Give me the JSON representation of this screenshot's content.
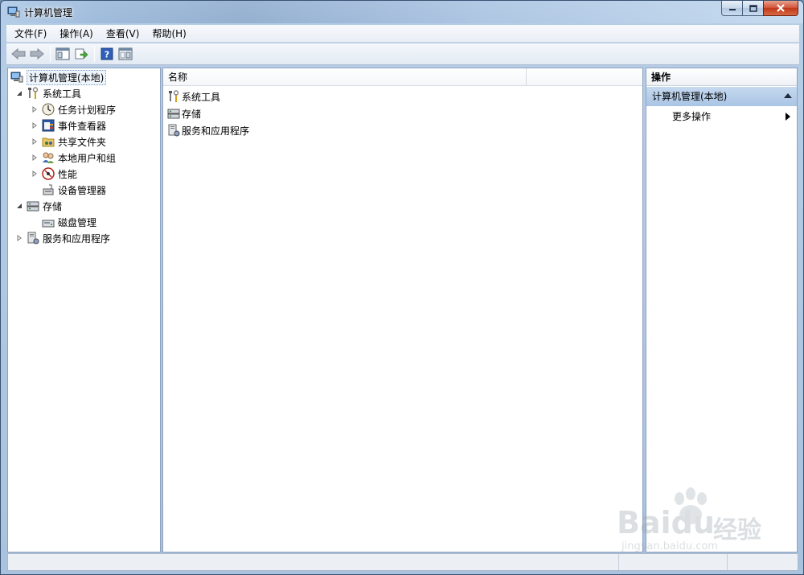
{
  "window": {
    "title": "计算机管理"
  },
  "menubar": {
    "items": [
      "文件(F)",
      "操作(A)",
      "查看(V)",
      "帮助(H)"
    ]
  },
  "toolbar": {
    "buttons": [
      "back-icon",
      "forward-icon",
      "show-tree-icon",
      "export-list-icon",
      "help-icon",
      "show-action-pane-icon"
    ]
  },
  "tree": {
    "root": "计算机管理(本地)",
    "items": [
      {
        "label": "系统工具",
        "level": 1,
        "state": "expanded",
        "icon": "tools-icon"
      },
      {
        "label": "任务计划程序",
        "level": 2,
        "state": "collapsed",
        "icon": "clock-icon"
      },
      {
        "label": "事件查看器",
        "level": 2,
        "state": "collapsed",
        "icon": "event-viewer-icon"
      },
      {
        "label": "共享文件夹",
        "level": 2,
        "state": "collapsed",
        "icon": "shared-folder-icon"
      },
      {
        "label": "本地用户和组",
        "level": 2,
        "state": "collapsed",
        "icon": "users-icon"
      },
      {
        "label": "性能",
        "level": 2,
        "state": "collapsed",
        "icon": "performance-icon"
      },
      {
        "label": "设备管理器",
        "level": 2,
        "state": "leaf",
        "icon": "device-manager-icon"
      },
      {
        "label": "存储",
        "level": 1,
        "state": "expanded",
        "icon": "storage-icon"
      },
      {
        "label": "磁盘管理",
        "level": 2,
        "state": "leaf",
        "icon": "disk-icon"
      },
      {
        "label": "服务和应用程序",
        "level": 1,
        "state": "collapsed",
        "icon": "services-icon"
      }
    ]
  },
  "main": {
    "column_header": "名称",
    "rows": [
      "系统工具",
      "存储",
      "服务和应用程序"
    ]
  },
  "actions": {
    "header": "操作",
    "section": "计算机管理(本地)",
    "more": "更多操作"
  },
  "watermark": {
    "brand": "Baidu",
    "brand_cn": "经验",
    "url": "jingyan.baidu.com"
  }
}
